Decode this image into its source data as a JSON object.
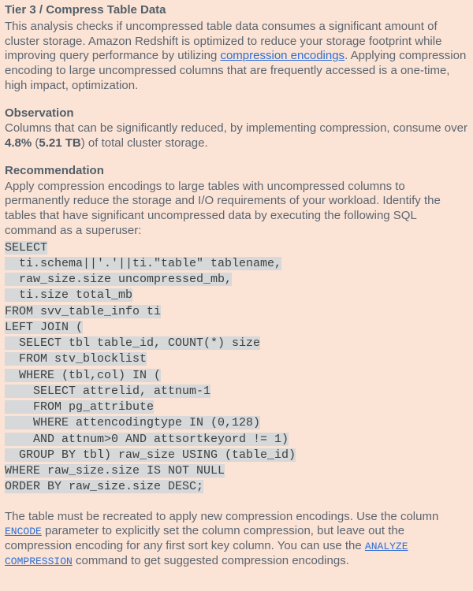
{
  "title": "Tier 3 / Compress Table Data",
  "description": {
    "part1": "This analysis checks if uncompressed table data consumes a significant amount of cluster storage. Amazon Redshift is optimized to reduce your storage footprint while improving query performance by utilizing ",
    "link_text": "compression encodings",
    "part2": ". Applying compression encoding to large uncompressed columns that are frequently accessed is a one-time, high impact, optimization."
  },
  "observation": {
    "heading": "Observation",
    "part1": "Columns that can be significantly reduced, by implementing compression, consume over",
    "pct": "4.8%",
    "size": "5.21 TB",
    "part2": "of total cluster storage."
  },
  "recommendation": {
    "heading": "Recommendation",
    "intro": "Apply compression encodings to large tables with uncompressed columns to permanently reduce the storage and I/O requirements of your workload. Identify the tables that have significant uncompressed data by executing the following SQL command as a superuser:",
    "sql": [
      "SELECT",
      "  ti.schema||'.'||ti.\"table\" tablename,",
      "  raw_size.size uncompressed_mb,",
      "  ti.size total_mb",
      "FROM svv_table_info ti",
      "LEFT JOIN (",
      "  SELECT tbl table_id, COUNT(*) size",
      "  FROM stv_blocklist",
      "  WHERE (tbl,col) IN (",
      "    SELECT attrelid, attnum-1",
      "    FROM pg_attribute",
      "    WHERE attencodingtype IN (0,128)",
      "    AND attnum>0 AND attsortkeyord != 1)",
      "  GROUP BY tbl) raw_size USING (table_id)",
      "WHERE raw_size.size IS NOT NULL",
      "ORDER BY raw_size.size DESC;"
    ],
    "footer": {
      "part1": "The table must be recreated to apply new compression encodings. Use the column",
      "code1": "ENCODE",
      "part2": "parameter to explicitly set the column compression, but leave out the compression encoding for any first sort key column. You can use the",
      "code2": "ANALYZE COMPRESSION",
      "part3": "command to get suggested compression encodings."
    }
  }
}
